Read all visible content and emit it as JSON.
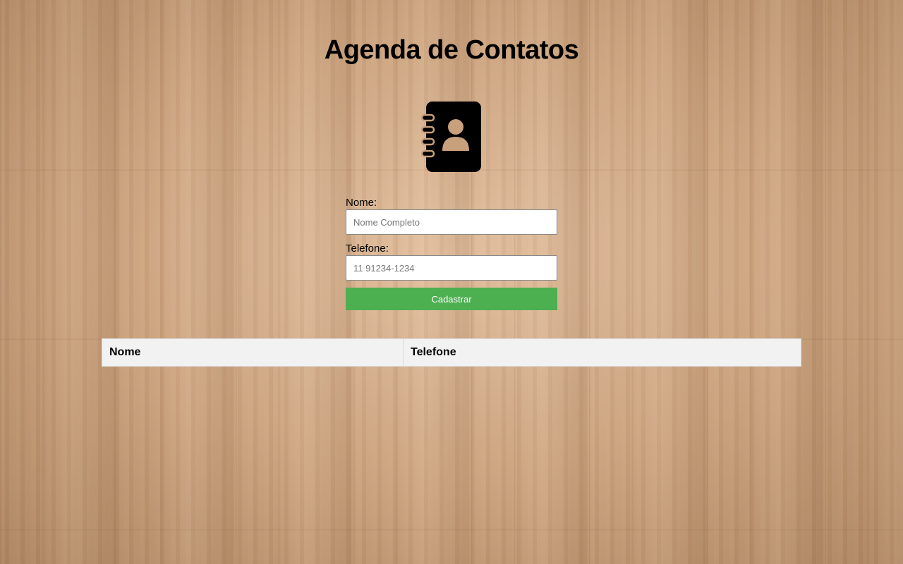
{
  "header": {
    "title": "Agenda de Contatos",
    "logo_icon": "contact-book-icon"
  },
  "form": {
    "name_label": "Nome:",
    "name_placeholder": "Nome Completo",
    "name_value": "",
    "phone_label": "Telefone:",
    "phone_placeholder": "11 91234-1234",
    "phone_value": "",
    "submit_label": "Cadastrar",
    "submit_color": "#4caf50"
  },
  "table": {
    "columns": [
      "Nome",
      "Telefone"
    ],
    "rows": []
  }
}
